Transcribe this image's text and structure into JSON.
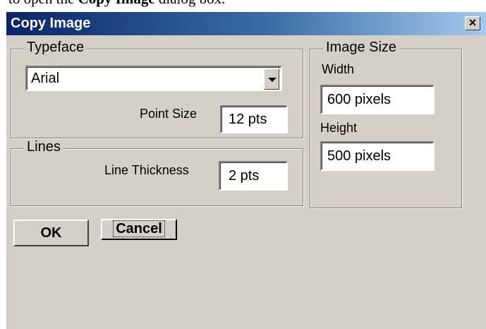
{
  "caption": {
    "prefix": "to open the ",
    "bold": "Copy Image",
    "suffix": " dialog box."
  },
  "dialog": {
    "title": "Copy Image",
    "close_label": "×"
  },
  "typeface": {
    "legend": "Typeface",
    "font_value": "Arial",
    "point_size_label": "Point Size",
    "point_size_value": "12  pts"
  },
  "lines": {
    "legend": "Lines",
    "thickness_label": "Line Thickness",
    "thickness_value": "2  pts"
  },
  "image_size": {
    "legend": "Image Size",
    "width_label": "Width",
    "width_value": "600 pixels",
    "height_label": "Height",
    "height_value": "500 pixels"
  },
  "buttons": {
    "ok": "OK",
    "cancel": "Cancel"
  }
}
